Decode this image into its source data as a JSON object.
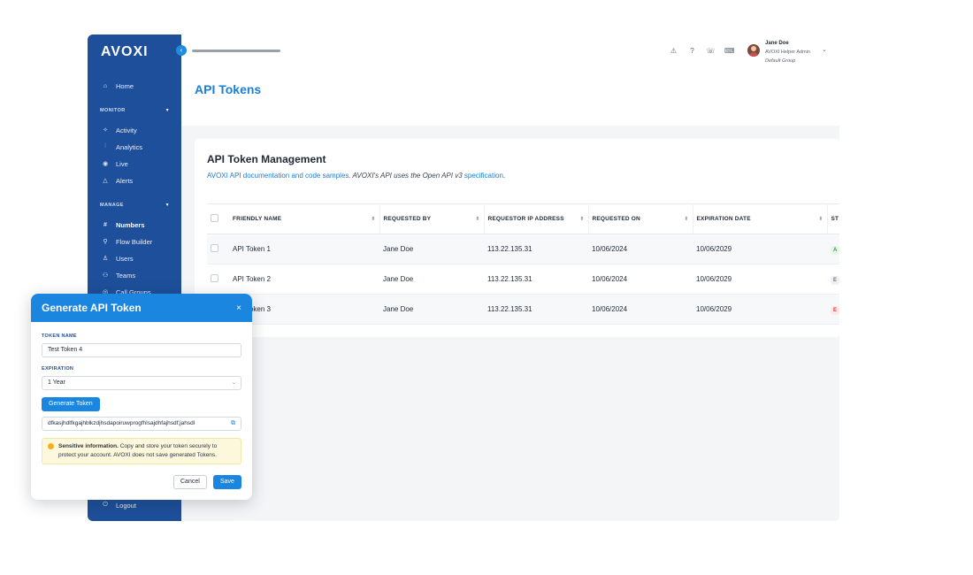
{
  "sidebar": {
    "logo": "AVOXI",
    "collapse_icon": "‹",
    "items": [
      {
        "label": "Home",
        "icon": "⌂"
      },
      {
        "label": "Activity",
        "icon": "✧"
      },
      {
        "label": "Analytics",
        "icon": "⫶"
      },
      {
        "label": "Live",
        "icon": "◉"
      },
      {
        "label": "Alerts",
        "icon": "△"
      },
      {
        "label": "Numbers",
        "icon": "#"
      },
      {
        "label": "Flow Builder",
        "icon": "⚲"
      },
      {
        "label": "Users",
        "icon": "♙"
      },
      {
        "label": "Teams",
        "icon": "⚇"
      },
      {
        "label": "Call Groups",
        "icon": "◎"
      },
      {
        "label": "Logout",
        "icon": "⏻"
      }
    ],
    "sections": {
      "monitor": "MONITOR",
      "manage": "MANAGE"
    }
  },
  "header": {
    "user_name": "Jane Doe",
    "user_role": "AVOXI Helper Admin",
    "user_group": "Default Group"
  },
  "page": {
    "title": "API Tokens",
    "card_title": "API Token Management",
    "sub_link": "AVOXI API documentation and code samples",
    "sub_mid": ". AVOXI's API uses the Open API v3 ",
    "sub_link2": "specification",
    "sub_end": "."
  },
  "table": {
    "headers": [
      "FRIENDLY NAME",
      "REQUESTED BY",
      "REQUESTOR IP ADDRESS",
      "REQUESTED ON",
      "EXPIRATION DATE",
      "ST"
    ],
    "rows": [
      {
        "name": "API Token 1",
        "by": "Jane Doe",
        "ip": "113.22.135.31",
        "on": "10/06/2024",
        "exp": "10/06/2029",
        "status": "A"
      },
      {
        "name": "API Token 2",
        "by": "Jane Doe",
        "ip": "113.22.135.31",
        "on": "10/06/2024",
        "exp": "10/06/2029",
        "status": "E"
      },
      {
        "name": "API Token 3",
        "by": "Jane Doe",
        "ip": "113.22.135.31",
        "on": "10/06/2024",
        "exp": "10/06/2029",
        "status": "E"
      }
    ]
  },
  "modal": {
    "title": "Generate API Token",
    "close": "×",
    "token_name_label": "TOKEN NAME",
    "token_name_value": "Test Token 4",
    "expiration_label": "EXPIRATION",
    "expiration_value": "1 Year",
    "generate_label": "Generate Token",
    "token_value": "dfkasjhdlfkgajhblkzdjhsdapoiruwprogfhlsajdhfajhsdf;jahsdl",
    "alert_bold": "Sensitive information.",
    "alert_text": " Copy and store your token securely to protect your account. AVOXI does not save generated Tokens.",
    "cancel_label": "Cancel",
    "save_label": "Save"
  }
}
